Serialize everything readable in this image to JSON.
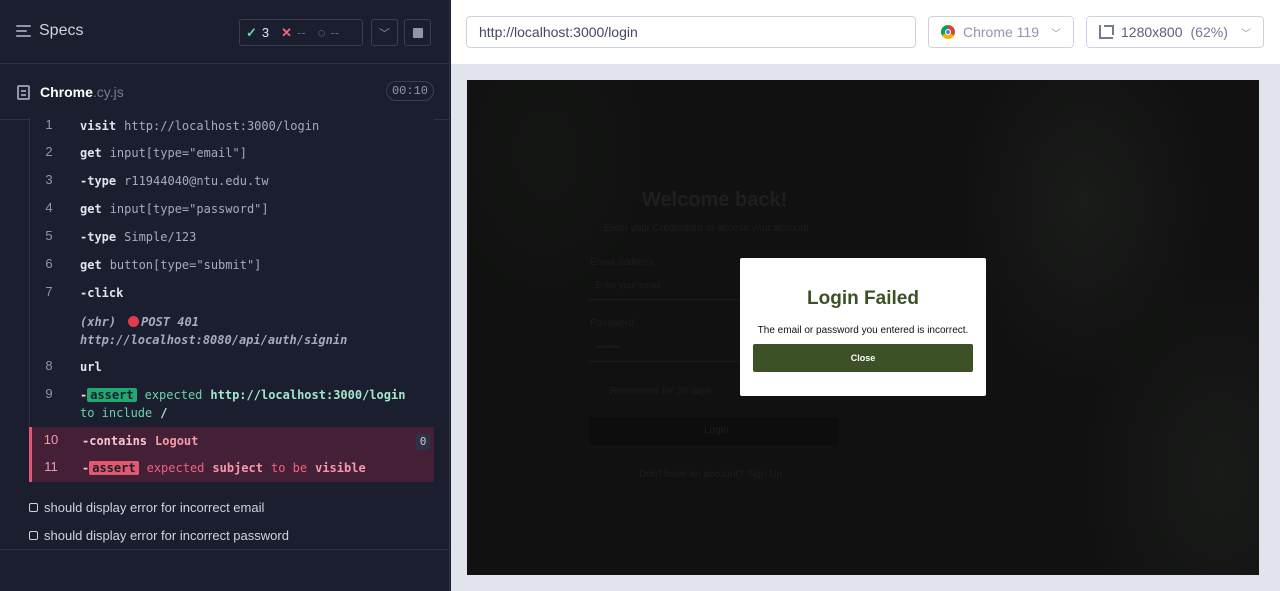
{
  "reporter": {
    "specs_label": "Specs",
    "stats": {
      "passed": "3",
      "failed": "--",
      "pending": "--"
    },
    "spec": {
      "name": "Chrome",
      "ext": ".cy.js",
      "duration": "00:10"
    },
    "commands": [
      {
        "num": "1",
        "name": "visit",
        "arg": "http://localhost:3000/login"
      },
      {
        "num": "2",
        "name": "get",
        "arg": "input[type=\"email\"]"
      },
      {
        "num": "3",
        "name": "-type",
        "arg": "r11944040@ntu.edu.tw"
      },
      {
        "num": "4",
        "name": "get",
        "arg": "input[type=\"password\"]"
      },
      {
        "num": "5",
        "name": "-type",
        "arg": "Simple/123"
      },
      {
        "num": "6",
        "name": "get",
        "arg": "button[type=\"submit\"]"
      },
      {
        "num": "7",
        "name": "-click",
        "arg": ""
      },
      {
        "xhr_label": "(xhr)",
        "xhr_status": "POST 401",
        "xhr_url": "http://localhost:8080/api/auth/signin"
      },
      {
        "num": "8",
        "name": "url",
        "arg": ""
      },
      {
        "num": "9",
        "dash": "-",
        "badge": "assert",
        "expected": "expected",
        "value": "http://localhost:3000/login",
        "to": "to include",
        "target": "/"
      },
      {
        "num": "10",
        "name": "-contains",
        "arg": "Logout",
        "count": "0"
      },
      {
        "num": "11",
        "dash": "-",
        "badge": "assert",
        "expected": "expected",
        "subject": "subject",
        "to": "to be",
        "target": "visible"
      }
    ],
    "tests": [
      "should display error for incorrect email",
      "should display error for incorrect password"
    ]
  },
  "aut": {
    "url": "http://localhost:3000/login",
    "browser": "Chrome 119",
    "viewport": "1280x800",
    "viewport_scale": "(62%)"
  },
  "app": {
    "ghost_title": "Welcome back!",
    "ghost_subtitle": "Enter your Credentials to access your account",
    "ghost_email_label": "Email address",
    "ghost_email_placeholder": "Enter your email",
    "ghost_password_label": "Password",
    "ghost_password_value": "••••••••",
    "ghost_remember": "Remember for 30 days",
    "ghost_login": "Login",
    "ghost_signup": "Don't have an account? Sign Up",
    "modal": {
      "title": "Login Failed",
      "message": "The email or password you entered is incorrect.",
      "close": "Close"
    }
  },
  "colors": {
    "reporter_bg": "#1b1e2e",
    "pass": "#69d3a7",
    "fail": "#e45770",
    "modal_accent": "#3c5126"
  }
}
